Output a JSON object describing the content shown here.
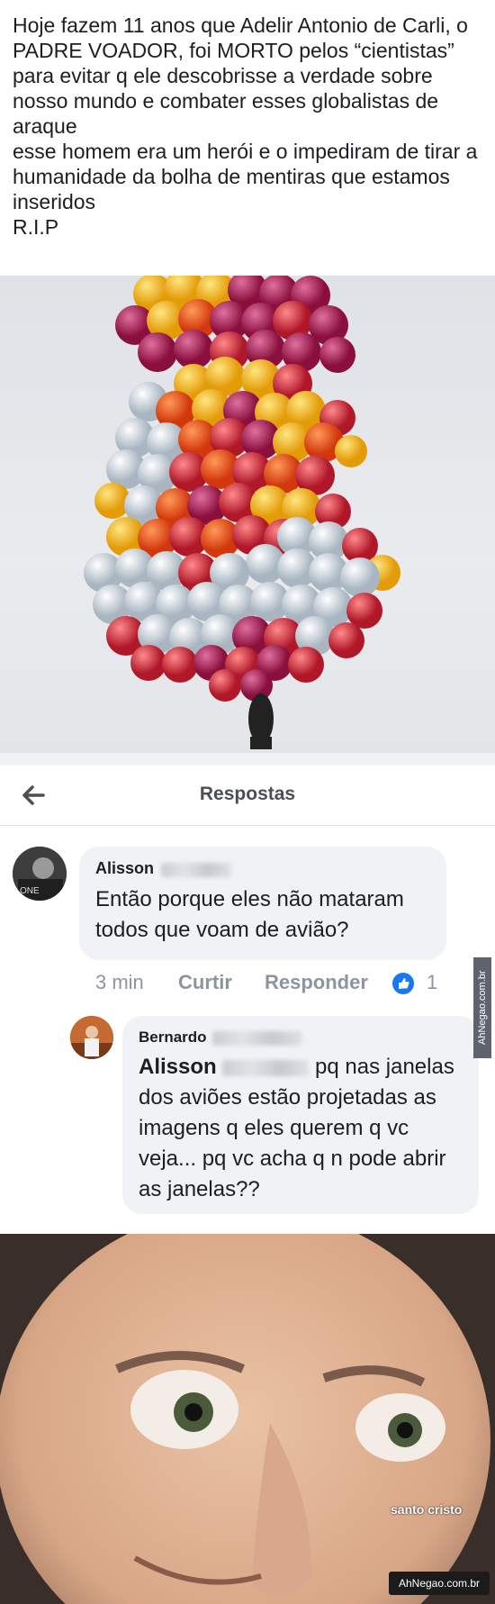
{
  "post": {
    "text": "Hoje fazem 11 anos que Adelir Antonio de Carli, o PADRE VOADOR, foi MORTO pelos “cientistas” para evitar q ele descobrisse a verdade sobre nosso mundo e combater esses globalistas de araque\nesse homem era um herói e o impediram de tirar a humanidade da bolha de mentiras que estamos inseridos\nR.I.P"
  },
  "replies_panel": {
    "title": "Respostas",
    "back_icon": "arrow-left-icon"
  },
  "comment1": {
    "author": "Alisson",
    "text": "Então porque eles não mataram todos que voam de avião?",
    "time": "3 min",
    "like": "Curtir",
    "reply": "Responder",
    "reactions": "1"
  },
  "comment2": {
    "author": "Bernardo",
    "mention": "Alisson",
    "text": "pq nas janelas dos aviões estão projetadas as imagens q eles querem q vc veja... pq vc acha q n pode abrir as janelas??"
  },
  "watermark_side": "AhNegao.com.br",
  "meme": {
    "caption": "santo cristo",
    "brand": "AhNegao.com.br"
  },
  "colors": {
    "accent": "#1877f2",
    "bubble": "#f0f2f5",
    "muted": "#8d949e"
  }
}
